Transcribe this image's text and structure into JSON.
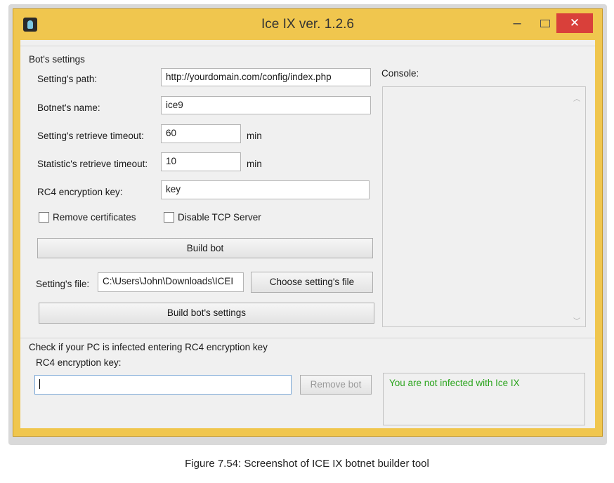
{
  "window": {
    "title": "Ice IX ver. 1.2.6",
    "minimize": "–",
    "close": "✕"
  },
  "bot_settings": {
    "group_label": "Bot's settings",
    "settings_path_label": "Setting's path:",
    "settings_path_value": "http://yourdomain.com/config/index.php",
    "botnet_name_label": "Botnet's name:",
    "botnet_name_value": "ice9",
    "settings_timeout_label": "Setting's retrieve timeout:",
    "settings_timeout_value": "60",
    "settings_timeout_unit": "min",
    "statistics_timeout_label": "Statistic's retrieve timeout:",
    "statistics_timeout_value": "10",
    "statistics_timeout_unit": "min",
    "rc4_label": "RC4 encryption key:",
    "rc4_value": "key",
    "remove_certificates_label": "Remove certificates",
    "remove_certificates_checked": false,
    "disable_tcp_label": "Disable TCP Server",
    "disable_tcp_checked": false,
    "build_bot_label": "Build bot",
    "settings_file_label": "Setting's file:",
    "settings_file_value": "C:\\Users\\John\\Downloads\\ICEI",
    "choose_file_label": "Choose setting's file",
    "build_settings_label": "Build bot's settings"
  },
  "console": {
    "label": "Console:",
    "content": ""
  },
  "infection_check": {
    "group_label": "Check if your PC is infected entering RC4 encryption key",
    "rc4_label": "RC4 encryption key:",
    "rc4_value": "",
    "remove_bot_label": "Remove bot",
    "result_text": "You are not infected with Ice IX"
  },
  "caption": "Figure 7.54: Screenshot of ICE IX botnet builder tool",
  "colors": {
    "frame": "#f0c64e",
    "close_button": "#d9403a",
    "result_text": "#2aa41c",
    "client_bg": "#f0f0f0"
  }
}
